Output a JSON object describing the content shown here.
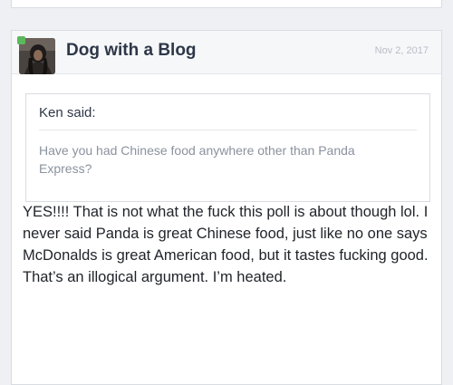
{
  "post": {
    "author": "Dog with a Blog",
    "date": "Nov 2, 2017",
    "quote": {
      "author_line": "Ken said:",
      "text": "Have you had Chinese food anywhere other than Panda Express?"
    },
    "body": "YES!!!! That is not what the fuck this poll is about though lol. I never said Panda is great Chinese food, just like no one says McDonalds is great American food, but it tastes fucking good. That’s an illogical argument. I’m heated."
  },
  "colors": {
    "online_indicator": "#5cb85c",
    "author_name": "#2d3748",
    "quote_text": "#8a929e",
    "date_text": "#b8bdc5"
  },
  "icons": {
    "avatar": "user-avatar-photo",
    "status": "online-status-dot"
  }
}
